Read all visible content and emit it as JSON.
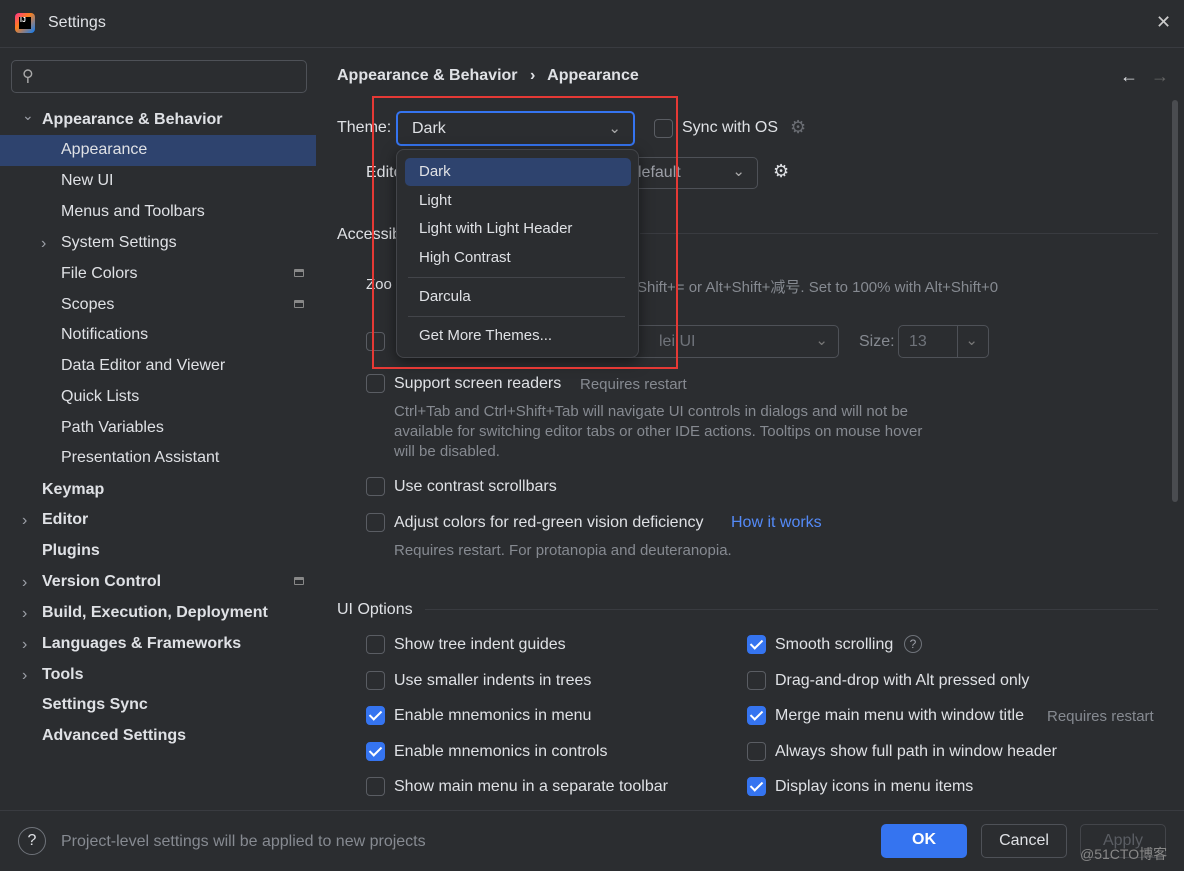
{
  "window": {
    "title": "Settings",
    "close": "✕"
  },
  "sidebar": {
    "search_placeholder": "",
    "items": [
      {
        "label": "Appearance & Behavior",
        "bold": true,
        "expanded": true
      },
      {
        "label": "Appearance",
        "selected": true
      },
      {
        "label": "New UI"
      },
      {
        "label": "Menus and Toolbars"
      },
      {
        "label": "System Settings"
      },
      {
        "label": "File Colors"
      },
      {
        "label": "Scopes"
      },
      {
        "label": "Notifications"
      },
      {
        "label": "Data Editor and Viewer"
      },
      {
        "label": "Quick Lists"
      },
      {
        "label": "Path Variables"
      },
      {
        "label": "Presentation Assistant"
      },
      {
        "label": "Keymap"
      },
      {
        "label": "Editor"
      },
      {
        "label": "Plugins"
      },
      {
        "label": "Version Control"
      },
      {
        "label": "Build, Execution, Deployment"
      },
      {
        "label": "Languages & Frameworks"
      },
      {
        "label": "Tools"
      },
      {
        "label": "Settings Sync"
      },
      {
        "label": "Advanced Settings"
      }
    ]
  },
  "breadcrumb": {
    "parent": "Appearance & Behavior",
    "sep": "›",
    "current": "Appearance"
  },
  "theme": {
    "label": "Theme:",
    "value": "Dark",
    "sync_label": "Sync with OS"
  },
  "theme_dropdown": {
    "options": [
      "Dark",
      "Light",
      "Light with Light Header",
      "High Contrast",
      "Darcula",
      "Get More Themes..."
    ],
    "selected": "Dark"
  },
  "partial": {
    "editor_label": "Edito",
    "editor_value": "lefault",
    "accessibility": "Accessib",
    "zoom_label": "Zoo",
    "zoom_hint": "Shift+= or Alt+Shift+减号. Set to 100% with Alt+Shift+0",
    "font_value": "lei UI",
    "size_label": "Size:",
    "size_value": "13"
  },
  "accessibility": {
    "screen_readers": {
      "label": "Support screen readers",
      "note": "Requires restart",
      "desc1": "Ctrl+Tab and Ctrl+Shift+Tab will navigate UI controls in dialogs and will not be",
      "desc2": "available for switching editor tabs or other IDE actions. Tooltips on mouse hover",
      "desc3": "will be disabled.",
      "checked": false
    },
    "contrast": {
      "label": "Use contrast scrollbars",
      "checked": false
    },
    "colorblind": {
      "label": "Adjust colors for red-green vision deficiency",
      "link": "How it works",
      "desc": "Requires restart. For protanopia and deuteranopia.",
      "checked": false
    }
  },
  "ui_options": {
    "title": "UI Options",
    "left": [
      {
        "label": "Show tree indent guides",
        "checked": false
      },
      {
        "label": "Use smaller indents in trees",
        "checked": false
      },
      {
        "label": "Enable mnemonics in menu",
        "checked": true
      },
      {
        "label": "Enable mnemonics in controls",
        "checked": true
      },
      {
        "label": "Show main menu in a separate toolbar",
        "checked": false
      }
    ],
    "right": [
      {
        "label": "Smooth scrolling",
        "checked": true
      },
      {
        "label": "Drag-and-drop with Alt pressed only",
        "checked": false
      },
      {
        "label": "Merge main menu with window title",
        "note": "Requires restart",
        "checked": true
      },
      {
        "label": "Always show full path in window header",
        "checked": false
      },
      {
        "label": "Display icons in menu items",
        "checked": true
      }
    ]
  },
  "footer": {
    "help": "?",
    "hint": "Project-level settings will be applied to new projects",
    "ok": "OK",
    "cancel": "Cancel",
    "apply": "Apply",
    "watermark": "@51CTO博客"
  },
  "colors": {
    "accent": "#3574f0",
    "selection": "#2e436e",
    "highlight_box": "#e53935"
  }
}
